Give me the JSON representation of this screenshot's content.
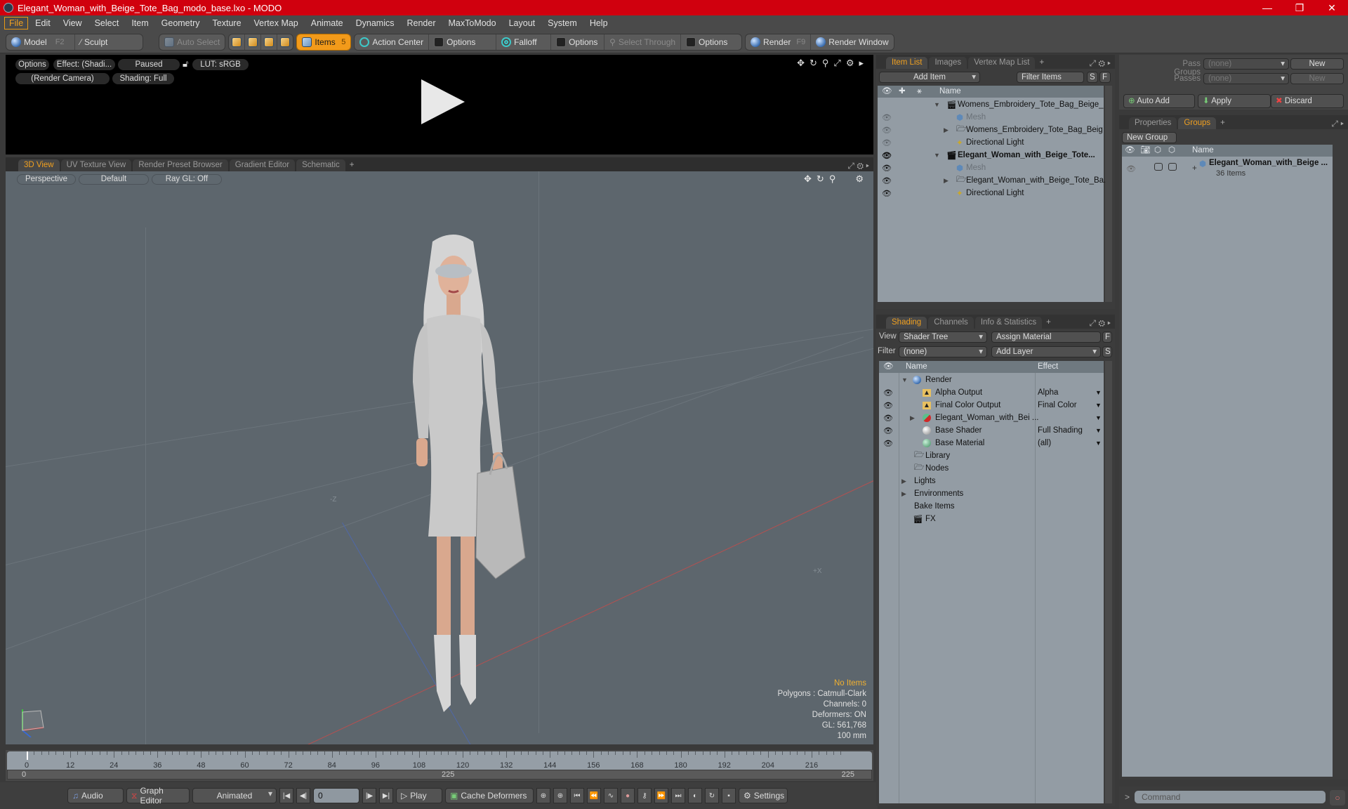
{
  "window": {
    "title": "Elegant_Woman_with_Beige_Tote_Bag_modo_base.lxo - MODO",
    "controls": [
      "minimize",
      "restore",
      "close"
    ]
  },
  "menubar": {
    "items": [
      "File",
      "Edit",
      "View",
      "Select",
      "Item",
      "Geometry",
      "Texture",
      "Vertex Map",
      "Animate",
      "Dynamics",
      "Render",
      "MaxToModo",
      "Layout",
      "System",
      "Help"
    ],
    "active": "File"
  },
  "toolbar": {
    "model": "Model",
    "model_key": "F2",
    "sculpt": "Sculpt",
    "auto_select": "Auto Select",
    "items": "Items",
    "items_count": "5",
    "action_center": "Action Center",
    "options1": "Options",
    "falloff": "Falloff",
    "options2": "Options",
    "select_through": "Select Through",
    "options3": "Options",
    "render": "Render",
    "render_key": "F9",
    "render_window": "Render Window"
  },
  "preview": {
    "options": "Options",
    "effect": "Effect: (Shadi...",
    "status": "Paused",
    "lut": "LUT: sRGB",
    "camera": "(Render Camera)",
    "shading": "Shading: Full"
  },
  "viewport_tabs": {
    "tabs": [
      "3D View",
      "UV Texture View",
      "Render Preset Browser",
      "Gradient Editor",
      "Schematic"
    ],
    "active": "3D View"
  },
  "viewport": {
    "projection": "Perspective",
    "style": "Default",
    "raygl": "Ray GL: Off",
    "axis_label_x": "+X",
    "axis_label_z": "-Z",
    "stats": {
      "selection": "No Items",
      "polygons": "Polygons : Catmull-Clark",
      "channels": "Channels: 0",
      "deformers": "Deformers: ON",
      "gl": "GL: 561,768",
      "scale": "100 mm"
    }
  },
  "timeline": {
    "ticks": [
      "0",
      "12",
      "24",
      "36",
      "48",
      "60",
      "72",
      "84",
      "96",
      "108",
      "120",
      "132",
      "144",
      "156",
      "168",
      "180",
      "192",
      "204",
      "216"
    ],
    "range_start": "0",
    "range_end": "225",
    "current_frame": 0
  },
  "transport": {
    "audio": "Audio",
    "graph_editor": "Graph Editor",
    "animated": "Animated",
    "frame_value": "0",
    "play": "Play",
    "cache_deformers": "Cache Deformers",
    "settings": "Settings"
  },
  "item_list": {
    "tabs": [
      "Item List",
      "Images",
      "Vertex Map List"
    ],
    "active_tab": "Item List",
    "add_item": "Add Item",
    "filter_placeholder": "Filter Items",
    "s_btn": "S",
    "f_btn": "F",
    "col_name": "Name",
    "rows": [
      {
        "label": "Womens_Embroidery_Tote_Bag_Beige_ ...",
        "type": "scene",
        "level": 0,
        "bold": false,
        "expanded": true,
        "visible": false
      },
      {
        "label": "Mesh",
        "type": "mesh",
        "level": 1,
        "dim": true,
        "visible": "dim"
      },
      {
        "label": "Womens_Embroidery_Tote_Bag_Beig ...",
        "type": "group",
        "level": 1,
        "collapsed": true,
        "visible": "dim"
      },
      {
        "label": "Directional Light",
        "type": "light",
        "level": 1,
        "visible": "dim"
      },
      {
        "label": "Elegant_Woman_with_Beige_Tote...",
        "type": "scene",
        "level": 0,
        "bold": true,
        "expanded": true,
        "visible": true
      },
      {
        "label": "Mesh",
        "type": "mesh",
        "level": 1,
        "dim": true,
        "visible": true
      },
      {
        "label": "Elegant_Woman_with_Beige_Tote_Ba...",
        "type": "group",
        "level": 1,
        "collapsed": true,
        "visible": true
      },
      {
        "label": "Directional Light",
        "type": "light",
        "level": 1,
        "visible": true
      }
    ]
  },
  "shading": {
    "tabs": [
      "Shading",
      "Channels",
      "Info & Statistics"
    ],
    "active_tab": "Shading",
    "view_label": "View",
    "view_value": "Shader Tree",
    "assign_material": "Assign Material",
    "filter_label": "Filter",
    "filter_value": "(none)",
    "add_layer": "Add Layer",
    "f_btn": "F",
    "s_btn": "S",
    "col_name": "Name",
    "col_effect": "Effect",
    "rows": [
      {
        "label": "Render",
        "effect": "",
        "level": 0,
        "icon": "render",
        "expanded": true,
        "eye": false
      },
      {
        "label": "Alpha Output",
        "effect": "Alpha",
        "level": 1,
        "icon": "output",
        "eye": true
      },
      {
        "label": "Final Color Output",
        "effect": "Final Color",
        "level": 1,
        "icon": "output",
        "eye": true
      },
      {
        "label": "Elegant_Woman_with_Bei ...",
        "effect": "",
        "level": 1,
        "icon": "material-group",
        "collapsed": true,
        "eye": true
      },
      {
        "label": "Base Shader",
        "effect": "Full Shading",
        "level": 1,
        "icon": "shader",
        "eye": true
      },
      {
        "label": "Base Material",
        "effect": "(all)",
        "level": 1,
        "icon": "material",
        "eye": true
      },
      {
        "label": "Library",
        "effect": null,
        "level": 0,
        "icon": "folder",
        "eye": false
      },
      {
        "label": "Nodes",
        "effect": null,
        "level": 0,
        "icon": "folder",
        "eye": false
      },
      {
        "label": "Lights",
        "effect": null,
        "level": -1,
        "icon": "none",
        "collapsed": true,
        "eye": false
      },
      {
        "label": "Environments",
        "effect": null,
        "level": -1,
        "icon": "none",
        "collapsed": true,
        "eye": false
      },
      {
        "label": "Bake Items",
        "effect": null,
        "level": -1,
        "icon": "none",
        "eye": false
      },
      {
        "label": "FX",
        "effect": null,
        "level": 0,
        "icon": "clapper",
        "eye": false
      }
    ]
  },
  "passes": {
    "pass_groups_label": "Pass Groups",
    "pass_groups_value": "(none)",
    "passes_label": "Passes",
    "passes_value": "(none)",
    "new": "New",
    "auto_add": "Auto Add",
    "apply": "Apply",
    "discard": "Discard"
  },
  "groups": {
    "tabs": [
      "Properties",
      "Groups"
    ],
    "active_tab": "Groups",
    "new_group": "New Group",
    "col_name": "Name",
    "item_name": "Elegant_Woman_with_Beige ...",
    "item_count": "36 Items"
  },
  "command": {
    "prompt": ">",
    "placeholder": "Command"
  },
  "colors": {
    "titlebar": "#d0000e",
    "accent": "#f29a1a",
    "viewport_bg": "#5d666d",
    "list_bg": "#939ca4"
  }
}
